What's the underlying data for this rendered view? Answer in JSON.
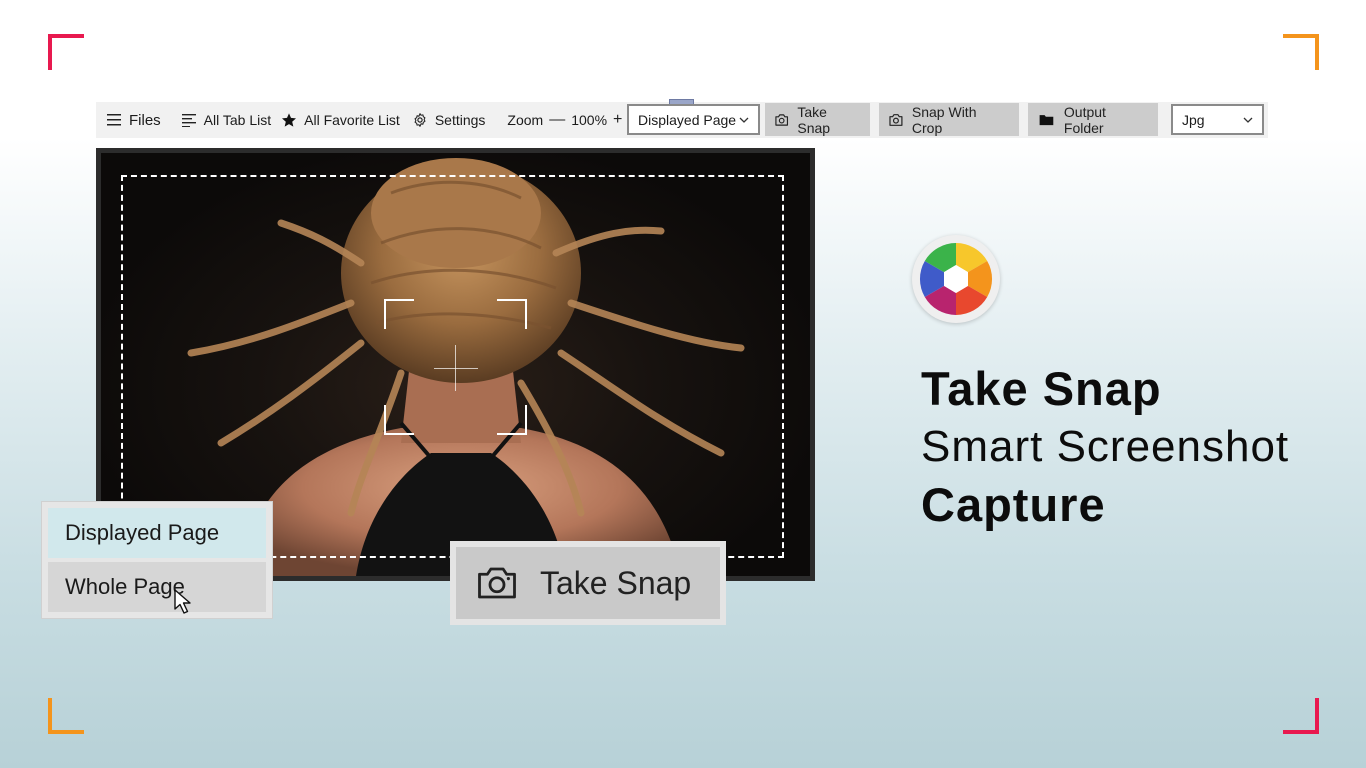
{
  "toolbar": {
    "files_label": "Files",
    "tab_list_label": "All Tab List",
    "favorite_list_label": "All Favorite List",
    "settings_label": "Settings",
    "zoom_label": "Zoom",
    "zoom_minus": "—",
    "zoom_value": "100%",
    "zoom_plus": "+",
    "capture_mode_value": "Displayed Page",
    "take_snap_label": "Take Snap",
    "snap_with_crop_label": "Snap With Crop",
    "output_folder_label": "Output Folder",
    "format_value": "Jpg"
  },
  "dropdown": {
    "options": [
      "Displayed Page",
      "Whole Page"
    ],
    "selected": "Displayed Page"
  },
  "big_button": {
    "label": "Take Snap"
  },
  "branding": {
    "line1": "Take Snap",
    "line2": "Smart Screenshot",
    "line3": "Capture"
  },
  "icons": {
    "menu": "hamburger-icon",
    "tab_list": "list-icon",
    "favorite": "star-icon",
    "settings": "gear-icon",
    "expand": "expand-icon",
    "camera": "camera-icon",
    "folder": "folder-icon",
    "chevron": "chevron-down-icon"
  },
  "colors": {
    "corner_pink": "#e8194f",
    "corner_orange": "#f4941c",
    "dropdown_selected": "#d1e8ec",
    "button_gray": "#cccccc"
  }
}
